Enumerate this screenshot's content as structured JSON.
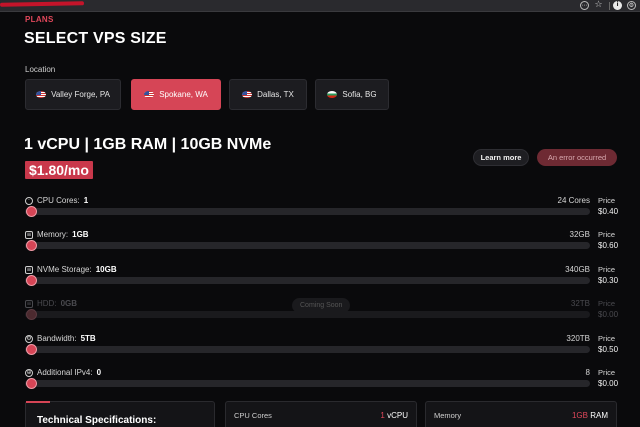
{
  "browser": {
    "url": "...com/vps"
  },
  "header": {
    "section": "PLANS",
    "title": "SELECT VPS SIZE"
  },
  "location": {
    "label": "Location",
    "options": [
      {
        "label": "Valley Forge, PA",
        "flag": "us-flag-icon",
        "selected": false
      },
      {
        "label": "Spokane, WA",
        "flag": "us-flag-icon",
        "selected": true
      },
      {
        "label": "Dallas, TX",
        "flag": "us-flag-icon",
        "selected": false
      },
      {
        "label": "Sofia, BG",
        "flag": "bg-flag-icon",
        "selected": false
      }
    ]
  },
  "plan": {
    "name": "1 vCPU | 1GB RAM | 10GB NVMe",
    "price": "$1.80/mo",
    "learn_more": "Learn more",
    "error_button": "An error occurred"
  },
  "sliders": [
    {
      "label": "CPU Cores:",
      "value": "1",
      "max": "24 Cores",
      "price_label": "Price",
      "price": "$0.40",
      "icon": "cpu-icon",
      "level": 0
    },
    {
      "label": "Memory:",
      "value": "1GB",
      "max": "32GB",
      "price_label": "Price",
      "price": "$0.60",
      "icon": "memory-icon",
      "level": 0
    },
    {
      "label": "NVMe Storage:",
      "value": "10GB",
      "max": "340GB",
      "price_label": "Price",
      "price": "$0.30",
      "icon": "storage-icon",
      "level": 0
    },
    {
      "label": "HDD:",
      "value": "0GB",
      "max": "32TB",
      "price_label": "Price",
      "price": "$0.00",
      "icon": "hdd-icon",
      "level": 0,
      "disabled": true,
      "badge": "Coming Soon"
    },
    {
      "label": "Bandwidth:",
      "value": "5TB",
      "max": "320TB",
      "price_label": "Price",
      "price": "$0.50",
      "icon": "bandwidth-icon",
      "level": 0
    },
    {
      "label": "Additional IPv4:",
      "value": "0",
      "max": "8",
      "price_label": "Price",
      "price": "$0.00",
      "icon": "globe-icon",
      "level": 0
    }
  ],
  "specs": {
    "title": "Technical Specifications:",
    "cpu_label": "CPU Cores",
    "cpu_num": "1",
    "cpu_unit": "vCPU",
    "mem_label": "Memory",
    "mem_num": "1GB",
    "mem_unit": "RAM"
  },
  "colors": {
    "accent": "#d64556",
    "background": "#0a0a0c"
  }
}
